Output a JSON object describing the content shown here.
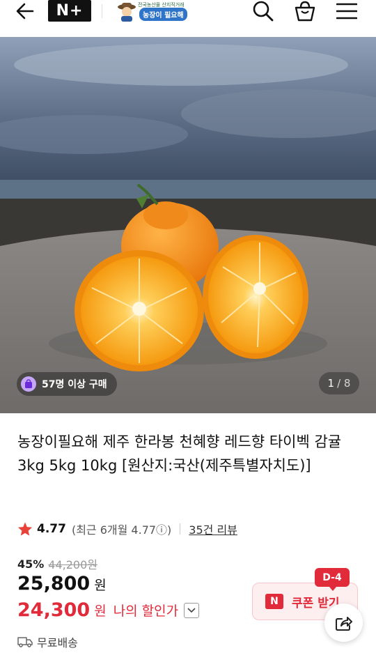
{
  "header": {
    "np_label": "N+",
    "brand_tagline": "전국농산물 산지직거래",
    "brand_name": "농장이 필요해",
    "icons": [
      "back-arrow-icon",
      "search-icon",
      "shopping-bag-icon",
      "menu-icon"
    ]
  },
  "hero": {
    "purchase_badge": "57명 이상 구매",
    "page_current": "1",
    "page_total": "/ 8"
  },
  "product": {
    "title": "농장이필요해 제주 한라봉 천혜향 레드향 타이벡 감귤 3kg 5kg 10kg [원산지:국산(제주특별자치도)]",
    "rating": "4.77",
    "recent_rating": "(최근 6개월 4.77ⓘ)",
    "reviews": "35건 리뷰",
    "discount_pct": "45%",
    "original_price": "44,200원",
    "price": "25,800",
    "price_unit": "원",
    "my_price": "24,300",
    "my_price_unit": "원",
    "my_price_label": "나의 할인가",
    "shipping": "무료배송"
  },
  "coupon": {
    "n_logo": "N",
    "label": "쿠폰 받기",
    "dday": "D-4"
  },
  "colors": {
    "accent_red": "#e12a3a",
    "star": "#e8423a",
    "brand_blue": "#2e74c9"
  }
}
